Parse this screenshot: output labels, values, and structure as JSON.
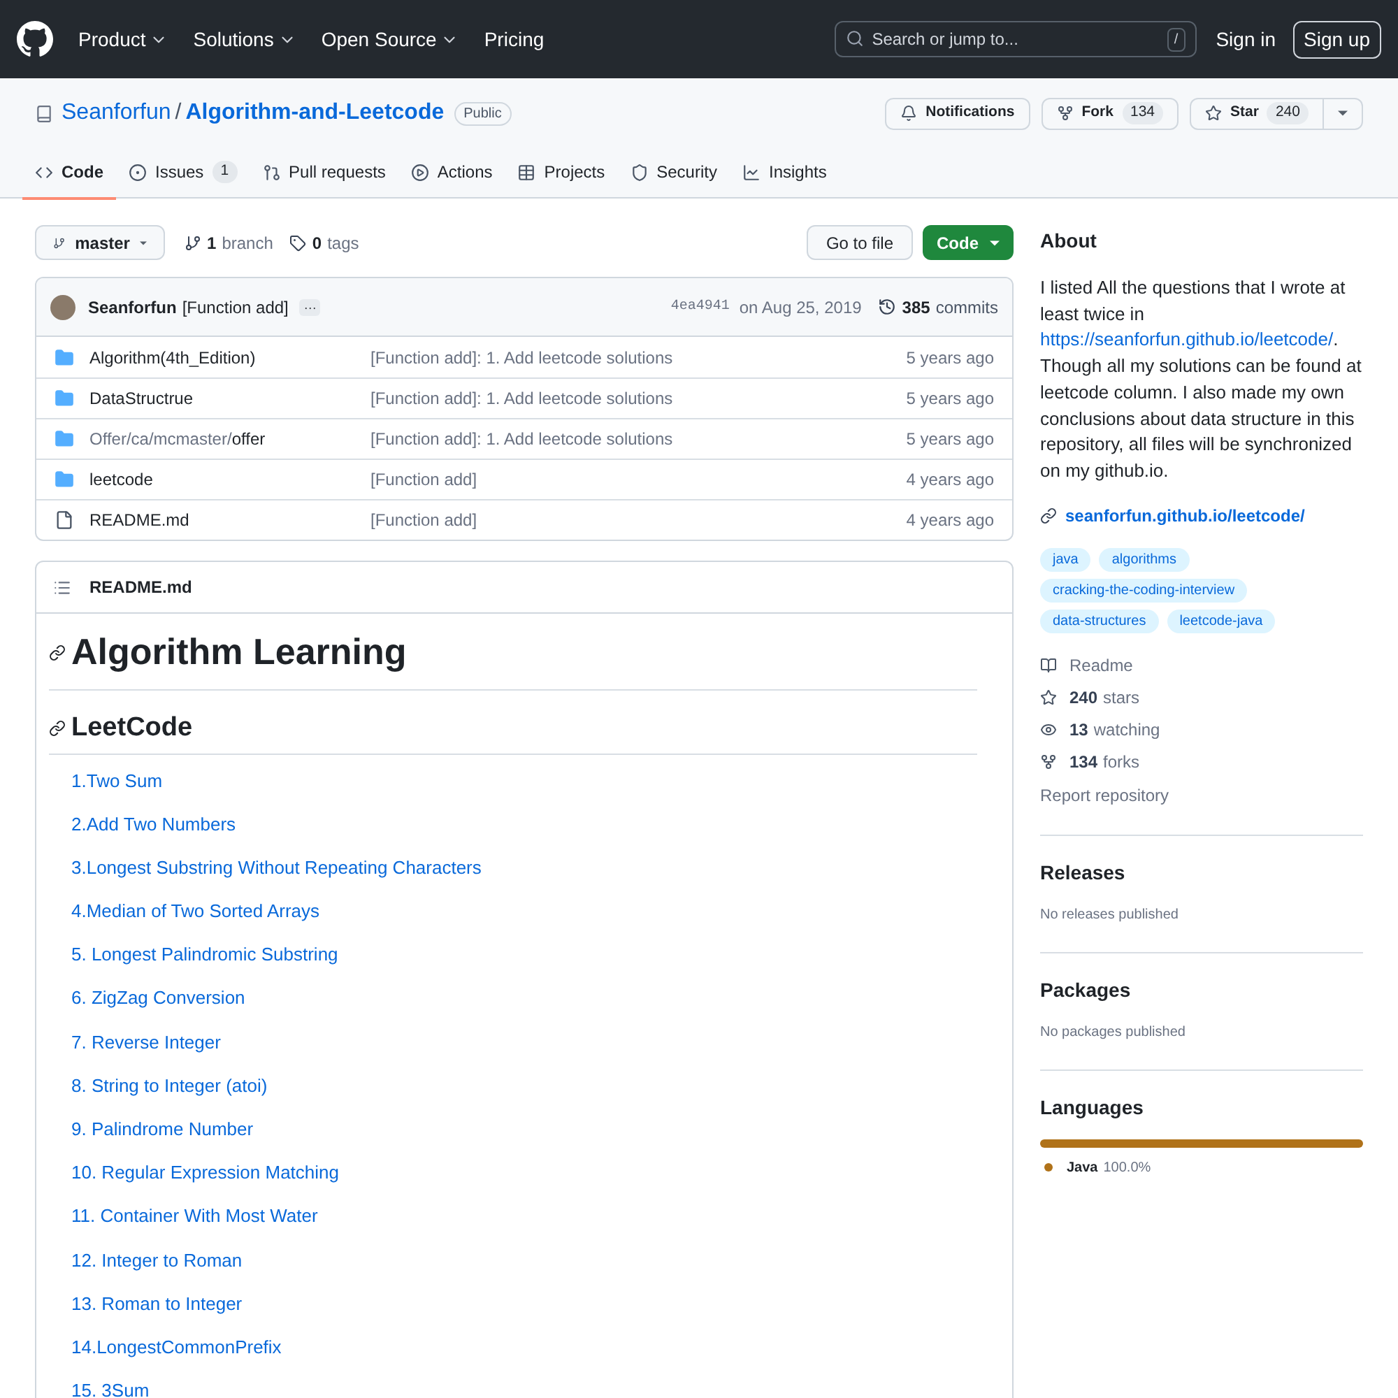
{
  "nav": {
    "items": [
      "Product",
      "Solutions",
      "Open Source",
      "Pricing"
    ],
    "search": {
      "placeholder": "Search or jump to...",
      "key": "/"
    },
    "sign_in": "Sign in",
    "sign_up": "Sign up"
  },
  "repo": {
    "owner": "Seanforfun",
    "separator": "/",
    "name": "Algorithm-and-Leetcode",
    "visibility": "Public",
    "actions": [
      {
        "kind": "notifications",
        "label": "Notifications"
      },
      {
        "kind": "fork",
        "label": "Fork",
        "count": "134"
      },
      {
        "kind": "star",
        "label": "Star",
        "count": "240"
      }
    ]
  },
  "tabs": [
    {
      "kind": "code",
      "label": "Code",
      "selected": true
    },
    {
      "kind": "issues",
      "label": "Issues",
      "count": "1",
      "selected": false
    },
    {
      "kind": "pulls",
      "label": "Pull requests",
      "selected": false
    },
    {
      "kind": "actions",
      "label": "Actions",
      "selected": false
    },
    {
      "kind": "projects",
      "label": "Projects",
      "selected": false
    },
    {
      "kind": "security",
      "label": "Security",
      "selected": false
    },
    {
      "kind": "insights",
      "label": "Insights",
      "selected": false
    }
  ],
  "toolbar": {
    "branch": "master",
    "branches": {
      "count": "1",
      "label": "branch"
    },
    "tags": {
      "count": "0",
      "label": "tags"
    },
    "go_to_file": "Go to file",
    "code": "Code"
  },
  "commit": {
    "author": "Seanforfun",
    "message": "[Function add]",
    "more": "···",
    "sha": "4ea4941",
    "date": "on Aug 25, 2019",
    "count": "385",
    "count_label": "commits"
  },
  "files": [
    {
      "kind": "folder",
      "name": "Algorithm(4th_Edition)",
      "message": "[Function add]: 1. Add leetcode solutions",
      "age": "5 years ago"
    },
    {
      "kind": "folder",
      "name": "DataStructrue",
      "message": "[Function add]: 1. Add leetcode solutions",
      "age": "5 years ago"
    },
    {
      "kind": "folder",
      "path_prefix": "Offer/ca/mcmaster/",
      "name": "offer",
      "message": "[Function add]: 1. Add leetcode solutions",
      "age": "5 years ago"
    },
    {
      "kind": "folder",
      "name": "leetcode",
      "message": "[Function add]",
      "age": "4 years ago"
    },
    {
      "kind": "file",
      "name": "README.md",
      "message": "[Function add]",
      "age": "4 years ago"
    }
  ],
  "readme": {
    "filename": "README.md",
    "title": "Algorithm Learning",
    "subtitle": "LeetCode",
    "items": [
      "1.Two Sum",
      "2.Add Two Numbers",
      "3.Longest Substring Without Repeating Characters",
      "4.Median of Two Sorted Arrays",
      "5. Longest Palindromic Substring",
      "6. ZigZag Conversion",
      "7. Reverse Integer",
      "8. String to Integer (atoi)",
      "9. Palindrome Number",
      "10. Regular Expression Matching",
      "11. Container With Most Water",
      "12. Integer to Roman",
      "13. Roman to Integer",
      "14.LongestCommonPrefix",
      "15. 3Sum"
    ]
  },
  "about": {
    "title": "About",
    "description_before": "I listed All the questions that I wrote at least twice in ",
    "description_link": "https://seanforfun.github.io/leetcode/",
    "description_after": ". Though all my solutions can be found at leetcode column. I also made my own conclusions about data structure in this repository, all files will be synchronized on my github.io.",
    "website": "seanforfun.github.io/leetcode/",
    "topics": [
      "java",
      "algorithms",
      "cracking-the-coding-interview",
      "data-structures",
      "leetcode-java"
    ],
    "stats": [
      {
        "kind": "readme",
        "label": "Readme"
      },
      {
        "kind": "stars",
        "count": "240",
        "label": "stars"
      },
      {
        "kind": "watching",
        "count": "13",
        "label": "watching"
      },
      {
        "kind": "forks",
        "count": "134",
        "label": "forks"
      }
    ],
    "report": "Report repository"
  },
  "releases": {
    "title": "Releases",
    "note": "No releases published"
  },
  "packages": {
    "title": "Packages",
    "note": "No packages published"
  },
  "languages": {
    "title": "Languages",
    "items": [
      {
        "name": "Java",
        "percent": "100.0%",
        "color": "#b07219",
        "level": 1
      }
    ]
  }
}
